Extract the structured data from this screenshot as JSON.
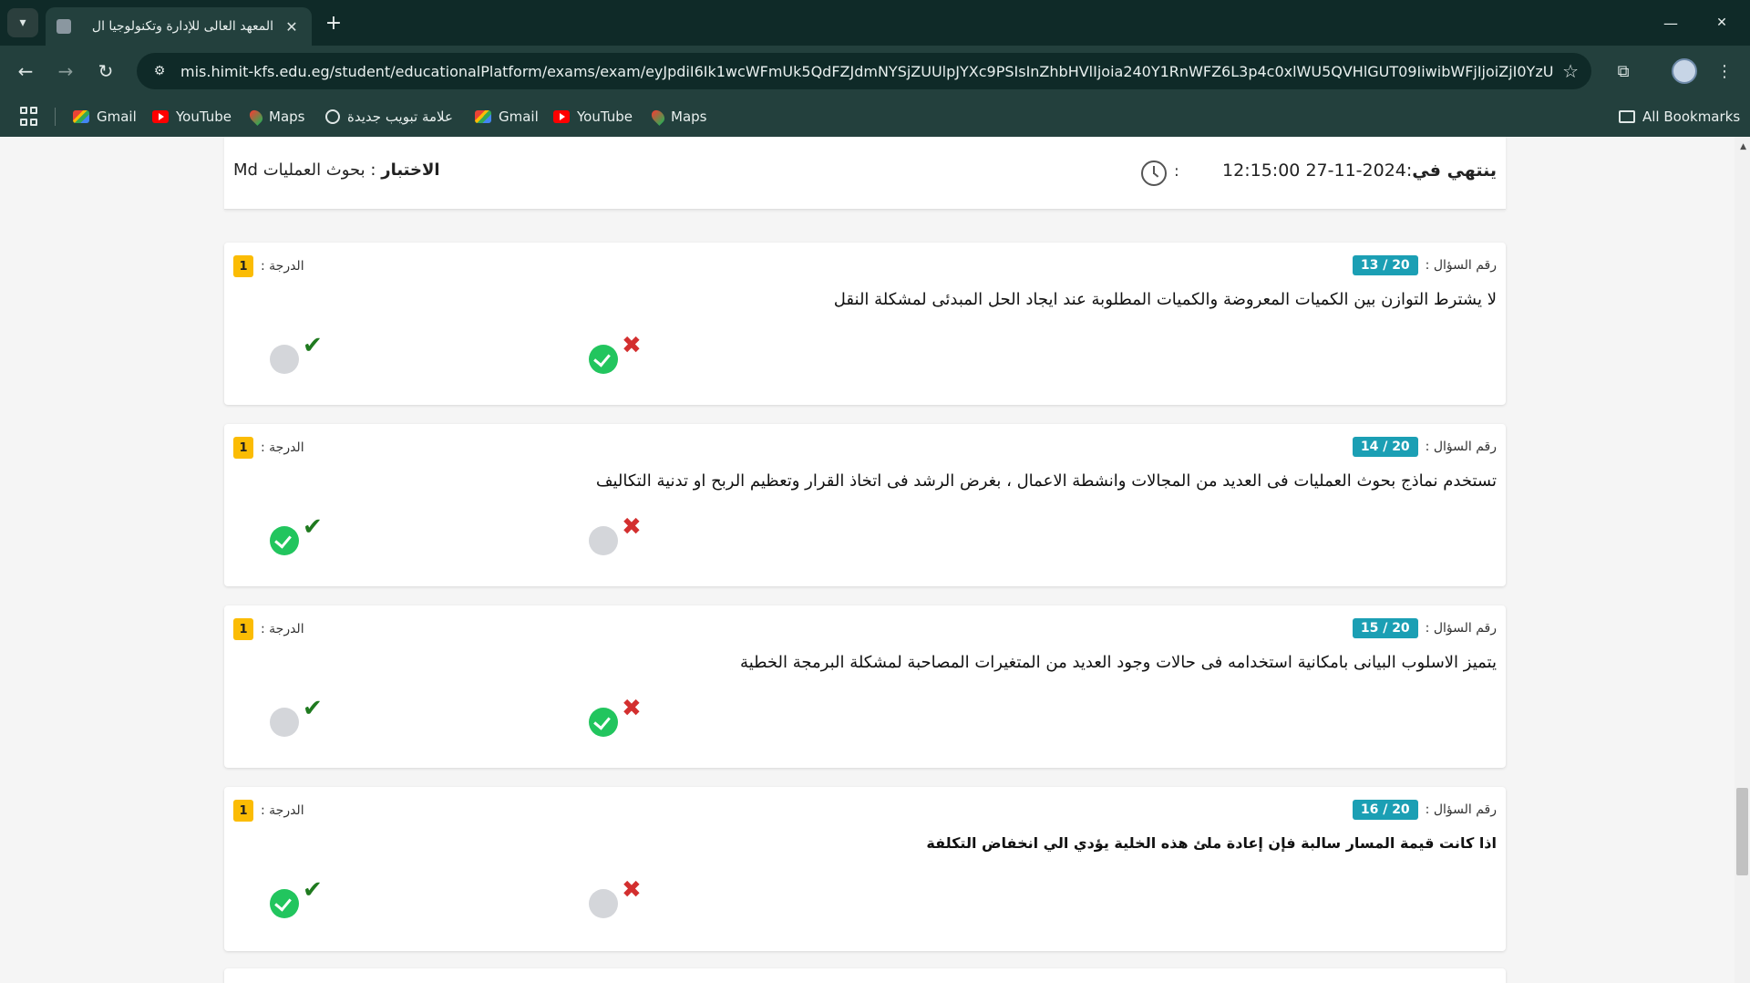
{
  "browser": {
    "tab_title": "المعهد العالى للإدارة وتكنولوجيا ال",
    "tab_close": "✕",
    "new_tab": "+",
    "url": "mis.himit-kfs.edu.eg/student/educationalPlatform/exams/exam/eyJpdiI6Ik1wcWFmUk5QdFZJdmNYSjZUUlpJYXc9PSIsInZhbHVlIjoia240Y1RnWFZ6L3p4c0xlWU5QVHlGUT09IiwibWFjIjoiZjI0YzU2...",
    "bookmarks": [
      {
        "label": "Gmail",
        "icon": "gmail-icon"
      },
      {
        "label": "YouTube",
        "icon": "youtube-icon"
      },
      {
        "label": "Maps",
        "icon": "maps-icon"
      },
      {
        "label": "علامة تبويب جديدة",
        "icon": "globe-icon"
      },
      {
        "label": "Gmail",
        "icon": "gmail-icon"
      },
      {
        "label": "YouTube",
        "icon": "youtube-icon"
      },
      {
        "label": "Maps",
        "icon": "maps-icon"
      }
    ],
    "all_bookmarks": "All Bookmarks"
  },
  "exam": {
    "ends_label": "ينتهي في",
    "ends_value": "2024-11-27 12:15:00",
    "timer_colon": ":",
    "title_label": "الاختبار",
    "title_value": ": بحوث العمليات Md"
  },
  "questions": [
    {
      "num_label": "رقم السؤال :",
      "num": "13 / 20",
      "grade_label": "الدرجة :",
      "grade": "1",
      "text": "لا يشترط التوازن بين الكميات المعروضة والكميات المطلوبة عند ايجاد الحل المبدئى لمشكلة النقل",
      "selected": "false"
    },
    {
      "num_label": "رقم السؤال :",
      "num": "14 / 20",
      "grade_label": "الدرجة :",
      "grade": "1",
      "text": "تستخدم نماذج بحوث العمليات فى العديد من المجالات وانشطة الاعمال ، بغرض الرشد فى اتخاذ القرار وتعظيم الربح او تدنية التكاليف",
      "selected": "true"
    },
    {
      "num_label": "رقم السؤال :",
      "num": "15 / 20",
      "grade_label": "الدرجة :",
      "grade": "1",
      "text": "يتميز الاسلوب البيانى بامكانية استخدامه فى حالات وجود العديد من المتغيرات المصاحبة لمشكلة البرمجة الخطية",
      "selected": "false"
    },
    {
      "num_label": "رقم السؤال :",
      "num": "16 / 20",
      "grade_label": "الدرجة :",
      "grade": "1",
      "text": "اذا كانت قيمة المسار سالبة فإن إعادة ملئ هذه الخلية يؤدي الي انخفاض التكلفة",
      "selected": "true"
    }
  ],
  "marks": {
    "true": "✔",
    "false": "✖"
  },
  "colors": {
    "badge": "#1b9fb4",
    "grade": "#fbbc04",
    "selected": "#22c55e",
    "unselected": "#d4d6da"
  }
}
